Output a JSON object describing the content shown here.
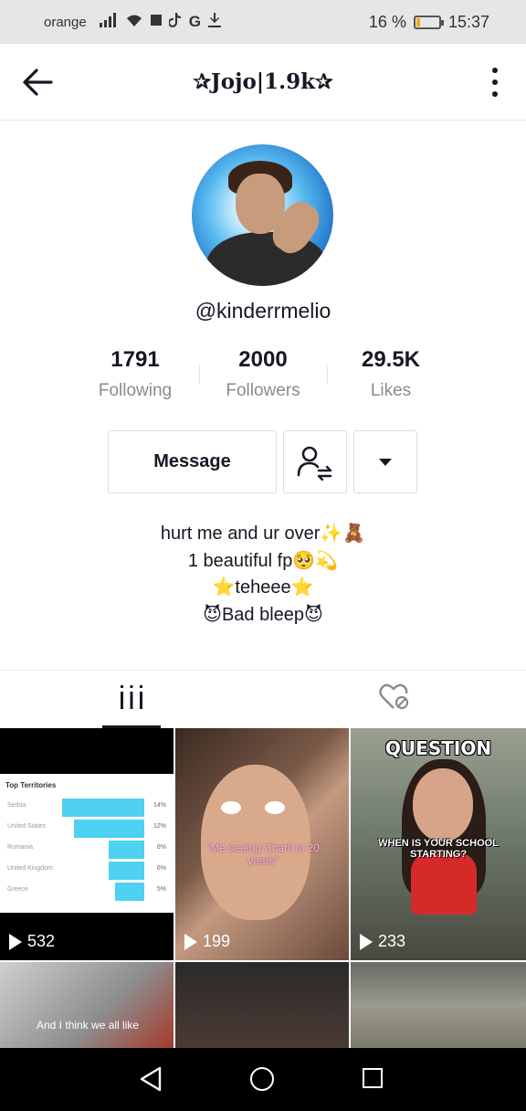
{
  "status_bar": {
    "carrier": "orange",
    "battery_text": "16 %",
    "battery_level": 0.16,
    "time": "15:37",
    "icons": [
      "signal-icon",
      "wifi-icon",
      "stop-icon",
      "tiktok-icon",
      "g-icon",
      "download-icon"
    ]
  },
  "header": {
    "title": "✰Jojo|1.9k✰",
    "back_icon": "back-arrow-icon",
    "more_icon": "more-vertical-icon"
  },
  "profile": {
    "avatar_icon": "avatar-photo",
    "username": "@kinderrmelio",
    "stats": [
      {
        "value": "1791",
        "label": "Following"
      },
      {
        "value": "2000",
        "label": "Followers"
      },
      {
        "value": "29.5K",
        "label": "Likes"
      }
    ],
    "message_label": "Message",
    "friend_icon": "friend-swap-icon",
    "dropdown_icon": "caret-down-icon",
    "bio": [
      "hurt me and ur over✨🧸",
      "1 beautiful fp🥺💫",
      "⭐teheee⭐",
      "😈Bad bleep😈"
    ]
  },
  "tabs": {
    "videos_icon": "grid-videos-icon",
    "liked_icon": "liked-hidden-icon"
  },
  "videos": [
    {
      "views": "532",
      "territories": {
        "title": "Top Territories",
        "rows": [
          {
            "name": "Serbia",
            "pct": "14%",
            "share": 0.14
          },
          {
            "name": "United States",
            "pct": "12%",
            "share": 0.12
          },
          {
            "name": "Romania",
            "pct": "6%",
            "share": 0.06
          },
          {
            "name": "United Kingdom",
            "pct": "6%",
            "share": 0.06
          },
          {
            "name": "Greece",
            "pct": "5%",
            "share": 0.05
          }
        ]
      }
    },
    {
      "views": "199",
      "caption": "\"Me seeing Charli in 20 years\""
    },
    {
      "views": "233",
      "title": "QUESTION",
      "caption": "WHEN IS YOUR SCHOOL STARTING?"
    },
    {
      "caption": "And I think we all like"
    },
    {},
    {}
  ],
  "nav_bar": {
    "back_icon": "nav-back-icon",
    "home_icon": "nav-home-icon",
    "recents_icon": "nav-recents-icon"
  },
  "colors": {
    "accent_bar": "#4fd1f1",
    "battery": "#f5a623",
    "text": "#161823",
    "muted": "#8a8b91"
  }
}
